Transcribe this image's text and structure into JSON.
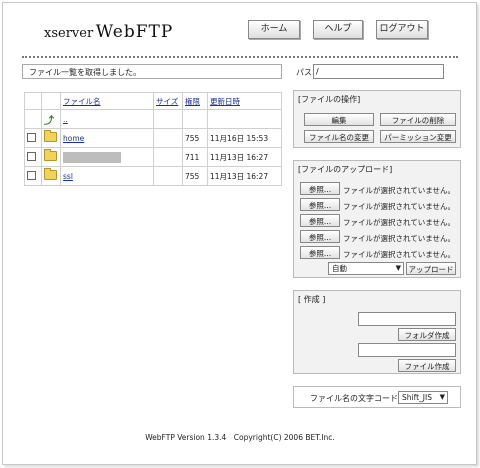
{
  "app": {
    "logo_part1": "xserver",
    "logo_part2": "WebFTP"
  },
  "nav": {
    "home": "ホーム",
    "help": "ヘルプ",
    "logout": "ログアウト"
  },
  "status_message": "ファイル一覧を取得しました。",
  "path": {
    "label": "パス:",
    "value": "/"
  },
  "table": {
    "headers": {
      "name": "ファイル名",
      "size": "サイズ",
      "perm": "権限",
      "date": "更新日時"
    },
    "parent": {
      "name": ".."
    },
    "rows": [
      {
        "name": "home",
        "size": "",
        "perm": "755",
        "date": "11月16日 15:53"
      },
      {
        "name": "",
        "size": "",
        "perm": "711",
        "date": "11月13日 16:27"
      },
      {
        "name": "ssl",
        "size": "",
        "perm": "755",
        "date": "11月13日 16:27"
      }
    ]
  },
  "ops": {
    "title": "[ファイルの操作]",
    "edit": "編集",
    "delete": "ファイルの削除",
    "rename": "ファイル名の変更",
    "chmod": "パーミッション変更"
  },
  "upload": {
    "title": "[ファイルのアップロード]",
    "browse": "参照...",
    "no_file": "ファイルが選択されていません。",
    "mode": "自動",
    "upload_button": "アップロード"
  },
  "create": {
    "title": "[ 作成 ]",
    "folder_button": "フォルダ作成",
    "file_button": "ファイル作成"
  },
  "encoding": {
    "label": "ファイル名の文字コード:",
    "value": "Shift_JIS"
  },
  "footer": "WebFTP Version 1.3.4　Copyright(C) 2006 BET.Inc."
}
